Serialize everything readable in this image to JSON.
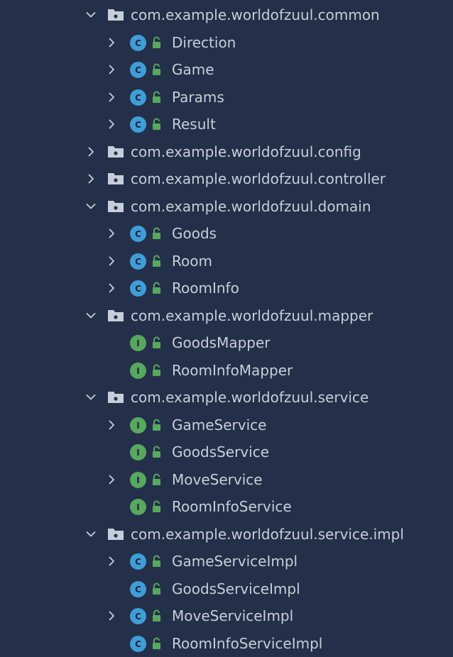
{
  "tree": [
    {
      "kind": "package",
      "label": "com.example.worldofzuul.common",
      "expanded": true
    },
    {
      "kind": "class",
      "icon": "C",
      "label": "Direction",
      "expandable": true
    },
    {
      "kind": "class",
      "icon": "C",
      "label": "Game",
      "expandable": true
    },
    {
      "kind": "class",
      "icon": "C",
      "label": "Params",
      "expandable": true
    },
    {
      "kind": "class",
      "icon": "C",
      "label": "Result",
      "expandable": true
    },
    {
      "kind": "package",
      "label": "com.example.worldofzuul.config",
      "expanded": false
    },
    {
      "kind": "package",
      "label": "com.example.worldofzuul.controller",
      "expanded": false
    },
    {
      "kind": "package",
      "label": "com.example.worldofzuul.domain",
      "expanded": true
    },
    {
      "kind": "class",
      "icon": "C",
      "label": "Goods",
      "expandable": true
    },
    {
      "kind": "class",
      "icon": "C",
      "label": "Room",
      "expandable": true
    },
    {
      "kind": "class",
      "icon": "C",
      "label": "RoomInfo",
      "expandable": true
    },
    {
      "kind": "package",
      "label": "com.example.worldofzuul.mapper",
      "expanded": true
    },
    {
      "kind": "interface",
      "icon": "I",
      "label": "GoodsMapper",
      "expandable": false
    },
    {
      "kind": "interface",
      "icon": "I",
      "label": "RoomInfoMapper",
      "expandable": false
    },
    {
      "kind": "package",
      "label": "com.example.worldofzuul.service",
      "expanded": true
    },
    {
      "kind": "interface",
      "icon": "I",
      "label": "GameService",
      "expandable": true
    },
    {
      "kind": "interface",
      "icon": "I",
      "label": "GoodsService",
      "expandable": false
    },
    {
      "kind": "interface",
      "icon": "I",
      "label": "MoveService",
      "expandable": true
    },
    {
      "kind": "interface",
      "icon": "I",
      "label": "RoomInfoService",
      "expandable": false
    },
    {
      "kind": "package",
      "label": "com.example.worldofzuul.service.impl",
      "expanded": true
    },
    {
      "kind": "class",
      "icon": "C",
      "label": "GameServiceImpl",
      "expandable": true
    },
    {
      "kind": "class",
      "icon": "C",
      "label": "GoodsServiceImpl",
      "expandable": false
    },
    {
      "kind": "class",
      "icon": "C",
      "label": "MoveServiceImpl",
      "expandable": true
    },
    {
      "kind": "class",
      "icon": "C",
      "label": "RoomInfoServiceImpl",
      "expandable": false
    }
  ],
  "colors": {
    "background": "#243049",
    "text": "#c7cedb",
    "chevron": "#c7cedb",
    "class_badge": "#3f9ed7",
    "interface_badge": "#58a85f",
    "lock": "#58a85f",
    "folder": "#c7cedb"
  },
  "icons": {
    "expanded": "chevron-down-icon",
    "collapsed": "chevron-right-icon",
    "package": "package-folder-icon",
    "class": "class-icon",
    "interface": "interface-icon",
    "visibility": "public-lock-icon"
  }
}
